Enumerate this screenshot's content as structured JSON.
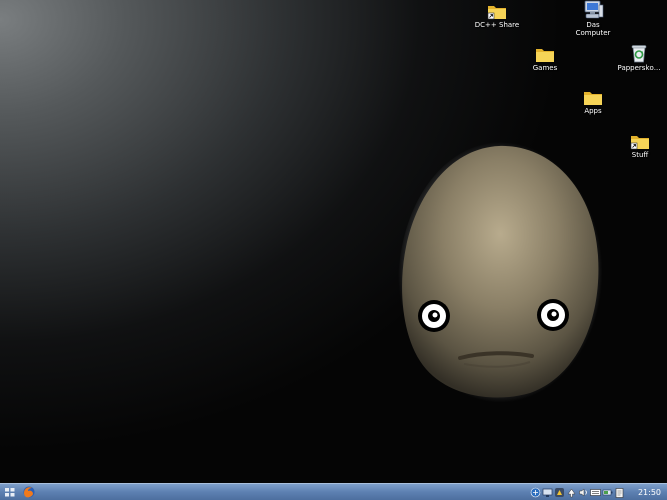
{
  "desktop": {
    "icons": [
      {
        "label": "DC++ Share",
        "icon": "folder-shortcut-icon"
      },
      {
        "label": "Das\nComputer",
        "icon": "computer-icon"
      },
      {
        "label": "Games",
        "icon": "folder-icon"
      },
      {
        "label": "Papperskо...",
        "icon": "trash-icon"
      },
      {
        "label": "Apps",
        "icon": "folder-icon"
      },
      {
        "label": "Stuff",
        "icon": "folder-shortcut-icon"
      }
    ],
    "wallpaper": "dark gradient with cartoon potato face"
  },
  "taskbar": {
    "launcher_icons": [
      "start-menu-icon",
      "firefox-icon"
    ],
    "tray_icons": [
      "network-icon",
      "display-icon",
      "app-icon",
      "update-icon",
      "volume-icon",
      "keyboard-icon",
      "power-icon",
      "clipboard-icon"
    ],
    "clock": "21:50"
  },
  "colors": {
    "taskbar": "#5d80b1",
    "folder": "#f3c93e"
  }
}
